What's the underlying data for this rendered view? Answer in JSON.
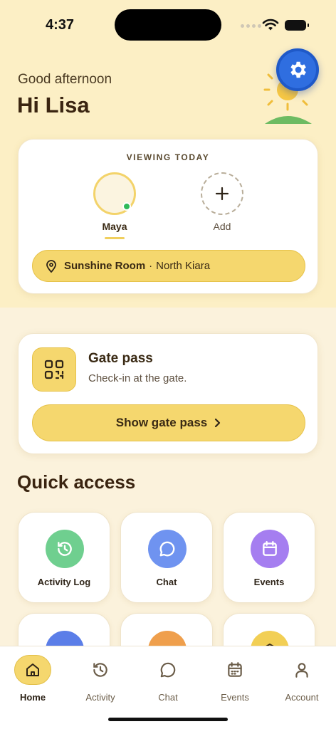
{
  "status_bar": {
    "time": "4:37"
  },
  "header": {
    "greeting": "Good afternoon",
    "name": "Hi Lisa"
  },
  "viewing": {
    "label": "VIEWING TODAY",
    "child_name": "Maya",
    "add_label": "Add",
    "room_name": "Sunshine Room",
    "room_separator": "·",
    "room_location": "North Kiara"
  },
  "gate_pass": {
    "title": "Gate pass",
    "subtitle": "Check-in at the gate.",
    "button_label": "Show gate pass"
  },
  "quick_access": {
    "title": "Quick access",
    "tiles": [
      {
        "label": "Activity Log",
        "icon": "history-icon",
        "color": "#6fcf8f"
      },
      {
        "label": "Chat",
        "icon": "chat-icon",
        "color": "#6f93f0"
      },
      {
        "label": "Events",
        "icon": "calendar-icon",
        "color": "#a57ef0"
      },
      {
        "label": "",
        "icon": "printer-icon",
        "color": "#5b7ee8"
      },
      {
        "label": "",
        "icon": "lock-icon",
        "color": "#ef9f4c"
      },
      {
        "label": "",
        "icon": "bank-icon",
        "color": "#f2cf55"
      }
    ]
  },
  "bottom_nav": {
    "items": [
      {
        "label": "Home",
        "icon": "home-icon",
        "active": true
      },
      {
        "label": "Activity",
        "icon": "history-icon",
        "active": false
      },
      {
        "label": "Chat",
        "icon": "chat-icon",
        "active": false
      },
      {
        "label": "Events",
        "icon": "calendar-icon",
        "active": false
      },
      {
        "label": "Account",
        "icon": "person-icon",
        "active": false
      }
    ]
  },
  "colors": {
    "accent": "#f5d76e",
    "settings_button": "#2f6ee0",
    "online": "#2fba5a"
  }
}
